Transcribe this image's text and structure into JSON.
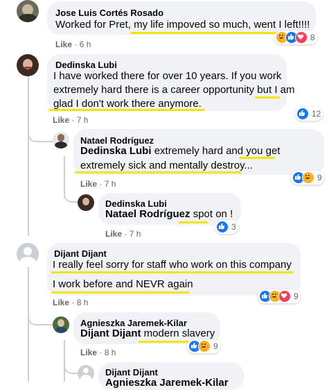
{
  "comments": [
    {
      "author": "Jose Luis Cortés Rosado",
      "text": "Worked for Pret, my life impoved so much, went I left!!!!",
      "like_label": "Like",
      "time": "6 h",
      "reaction_count": "8"
    },
    {
      "author": "Dedinska Lubi",
      "lines": [
        "I have worked there for over 10 years. If you work",
        "extremely hard there is a career opportunity but I am",
        "glad I don't work there anymore."
      ],
      "like_label": "Like",
      "time": "7 h",
      "reaction_count": "12"
    },
    {
      "author": "Natael Rodríguez",
      "mention": "Dedinska Lubi",
      "line1_rest": " extremely hard and you get",
      "line2": "extremely sick and mentally destroy...",
      "like_label": "Like",
      "time": "7 h",
      "reaction_count": "9"
    },
    {
      "author": "Dedinska Lubi",
      "mention": "Natael Rodríguez",
      "text_rest": " spot on !",
      "like_label": "Like",
      "time": "7 h",
      "reaction_count": "3"
    },
    {
      "author": "Dijant Dijant",
      "lines": [
        "I really feel sorry for staff who work on this company",
        "I work before and NEVR again"
      ],
      "like_label": "Like",
      "time": "8 h",
      "reaction_count": "9"
    },
    {
      "author": "Agnieszka Jaremek-Kilar",
      "mention": "Dijant Dijant",
      "text_rest": " modern slavery",
      "like_label": "Like",
      "time": "8 h",
      "reaction_count": "9"
    },
    {
      "author": "Dijant Dijant",
      "mention": "Agnieszka Jaremek-Kilar"
    }
  ],
  "colors": {
    "bubble": "#f0f2f5",
    "highlight": "#f2e600",
    "like_blue": "#1877f2",
    "haha_yellow": "#f7b125",
    "love_red": "#f33e58",
    "meta_gray": "#65676b"
  },
  "icons": [
    "avatar",
    "like-reaction-icon",
    "haha-reaction-icon",
    "love-reaction-icon"
  ]
}
